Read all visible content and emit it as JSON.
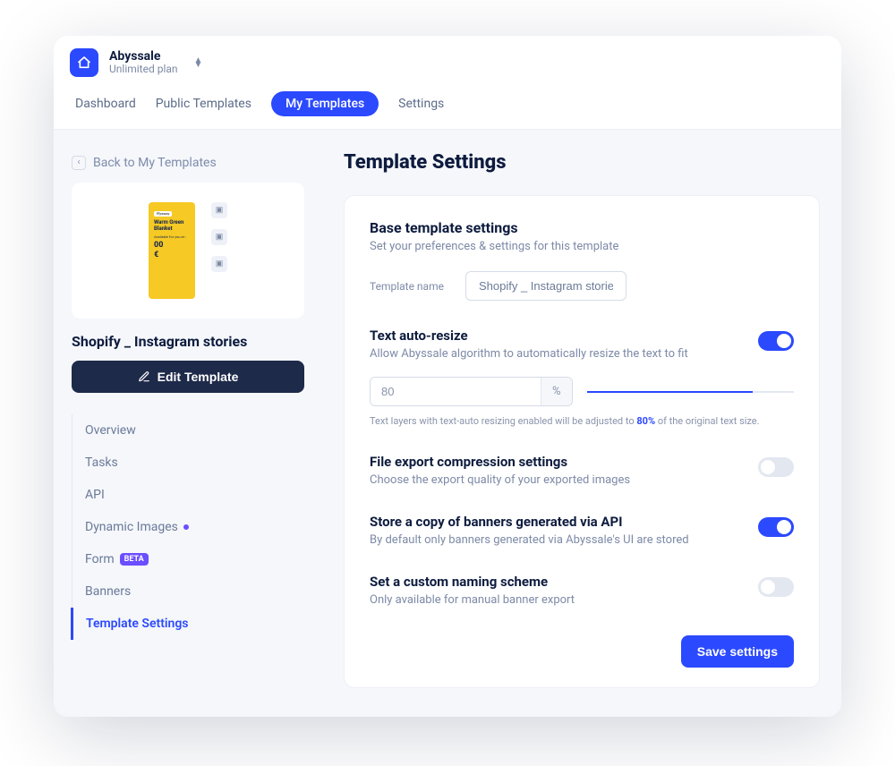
{
  "brand": {
    "name": "Abyssale",
    "plan": "Unlimited plan"
  },
  "tabs": {
    "dashboard": "Dashboard",
    "public": "Public Templates",
    "mine": "My Templates",
    "settings": "Settings"
  },
  "sidebar": {
    "back_label": "Back to My Templates",
    "template_title": "Shopify _ Instagram stories",
    "edit_label": "Edit Template",
    "preview": {
      "tag": "Flysway",
      "headline": "Warm Green Blanket",
      "avail": "Available for you at :",
      "price": "00",
      "currency": "€"
    },
    "menu": {
      "overview": "Overview",
      "tasks": "Tasks",
      "api": "API",
      "dynamic": "Dynamic Images",
      "form": "Form",
      "form_badge": "BETA",
      "banners": "Banners",
      "tmpl_settings": "Template Settings"
    }
  },
  "content": {
    "page_title": "Template Settings",
    "base": {
      "title": "Base template settings",
      "desc": "Set your preferences & settings for this template",
      "name_label": "Template name",
      "name_value": "Shopify _ Instagram stories"
    },
    "autoresize": {
      "title": "Text auto-resize",
      "desc": "Allow Abyssale algorithm to automatically resize the text to fit",
      "value": "80",
      "suffix": "%",
      "fill_percent": 80,
      "note_prefix": "Text layers with text-auto resizing enabled will be adjusted to ",
      "note_value": "80%",
      "note_suffix": " of the original text size."
    },
    "compression": {
      "title": "File export compression settings",
      "desc": "Choose the export quality of your exported images"
    },
    "store_copy": {
      "title": "Store a copy of banners generated via API",
      "desc": "By default only banners generated via Abyssale's UI are stored"
    },
    "naming": {
      "title": "Set a custom naming scheme",
      "desc": "Only available for manual banner export"
    },
    "save_label": "Save settings"
  }
}
